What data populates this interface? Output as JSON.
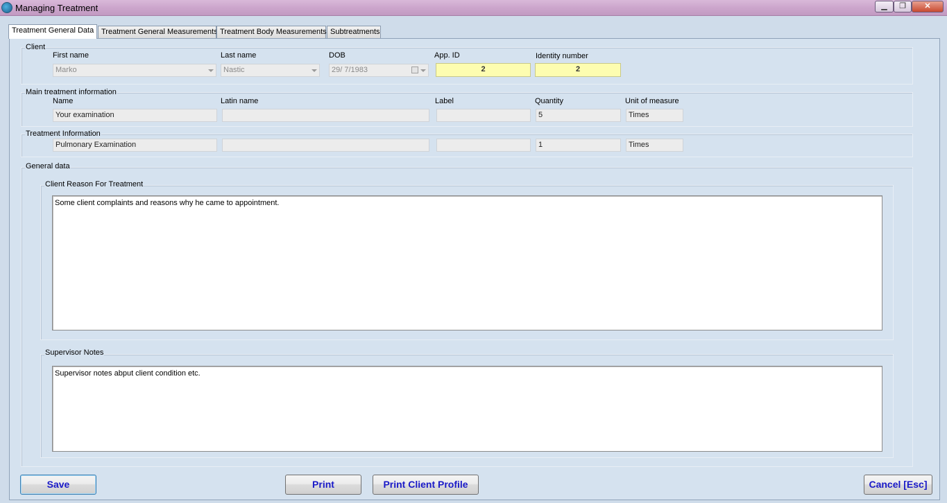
{
  "window": {
    "title": "Managing Treatment",
    "min_glyph": "▁",
    "max_glyph": "❐",
    "close_glyph": "✕"
  },
  "tabs": [
    {
      "label": "Treatment General Data",
      "active": true
    },
    {
      "label": "Treatment General Measurements",
      "active": false
    },
    {
      "label": "Treatment Body Measurements",
      "active": false
    },
    {
      "label": "Subtreatments",
      "active": false
    }
  ],
  "client": {
    "group_label": "Client",
    "first_name_label": "First name",
    "first_name_value": "Marko",
    "last_name_label": "Last name",
    "last_name_value": "Nastic",
    "dob_label": "DOB",
    "dob_value": "29/  7/1983",
    "app_id_label": "App. ID",
    "app_id_value": "2",
    "identity_label": "Identity number",
    "identity_value": "2"
  },
  "main_treatment": {
    "group_label": "Main treatment information",
    "name_label": "Name",
    "name_value": "Your examination",
    "latin_label": "Latin name",
    "latin_value": "",
    "label_label": "Label",
    "label_value": "",
    "quantity_label": "Quantity",
    "quantity_value": "5",
    "unit_label": "Unit of measure",
    "unit_value": "Times"
  },
  "treatment_info": {
    "group_label": "Treatment Information",
    "name_value": "Pulmonary Examination",
    "latin_value": "",
    "label_value": "",
    "quantity_value": "1",
    "unit_value": "Times"
  },
  "general_data": {
    "group_label": "General data",
    "reason_label": "Client Reason For Treatment",
    "reason_text": "Some client complaints and reasons why he came to appointment.",
    "supervisor_label": "Supervisor Notes",
    "supervisor_text": "Supervisor notes abput client condition etc."
  },
  "buttons": {
    "save": "Save",
    "print": "Print",
    "print_profile": "Print Client Profile",
    "cancel": "Cancel [Esc]"
  }
}
